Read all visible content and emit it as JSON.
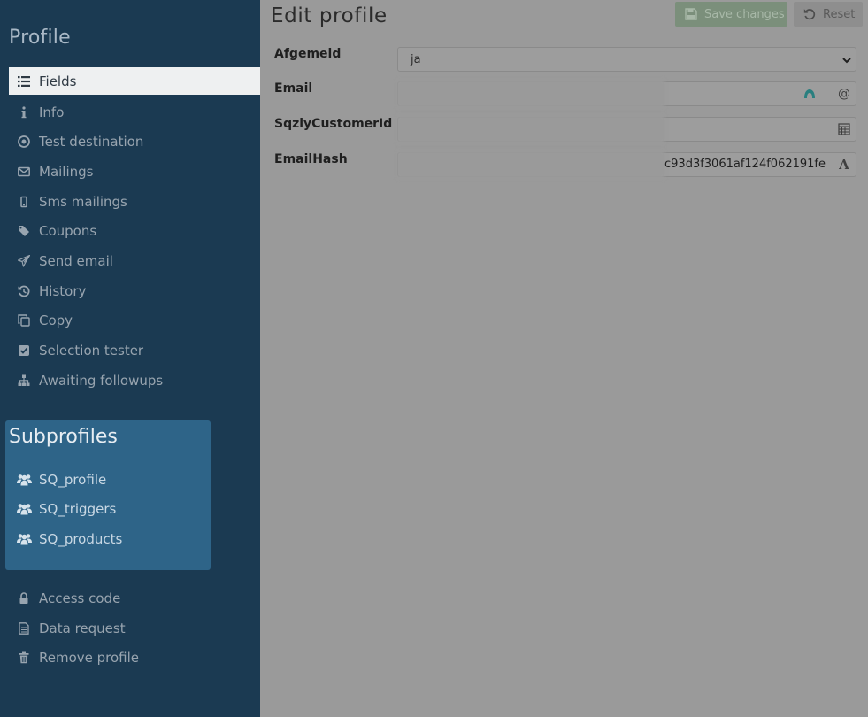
{
  "sidebar": {
    "title": "Profile",
    "items": [
      {
        "label": "Fields",
        "icon": "list-icon",
        "active": true
      },
      {
        "label": "Info",
        "icon": "info-icon"
      },
      {
        "label": "Test destination",
        "icon": "target-icon"
      },
      {
        "label": "Mailings",
        "icon": "envelope-icon"
      },
      {
        "label": "Sms mailings",
        "icon": "mobile-icon"
      },
      {
        "label": "Coupons",
        "icon": "tag-icon"
      },
      {
        "label": "Send email",
        "icon": "paper-plane-icon"
      },
      {
        "label": "History",
        "icon": "history-icon"
      },
      {
        "label": "Copy",
        "icon": "copy-icon"
      },
      {
        "label": "Selection tester",
        "icon": "check-square-icon"
      },
      {
        "label": "Awaiting followups",
        "icon": "sitemap-icon"
      }
    ],
    "subprofiles": {
      "title": "Subprofiles",
      "items": [
        {
          "label": "SQ_profile",
          "icon": "users-icon"
        },
        {
          "label": "SQ_triggers",
          "icon": "users-icon"
        },
        {
          "label": "SQ_products",
          "icon": "users-icon"
        }
      ]
    },
    "bottom_items": [
      {
        "label": "Access code",
        "icon": "lock-icon"
      },
      {
        "label": "Data request",
        "icon": "document-icon"
      },
      {
        "label": "Remove profile",
        "icon": "trash-icon"
      }
    ]
  },
  "main": {
    "title": "Edit profile",
    "toolbar": {
      "save_label": "Save changes",
      "reset_label": "Reset"
    },
    "fields": [
      {
        "label": "Afgemeld",
        "type": "select",
        "value": "ja"
      },
      {
        "label": "Email",
        "type": "email",
        "addon": "@"
      },
      {
        "label": "SqzlyCustomerId",
        "type": "number"
      },
      {
        "label": "EmailHash",
        "type": "text",
        "value_tail": "c93d3f3061af124f062191fe"
      }
    ]
  },
  "colors": {
    "sidebar_bg": "#1b3a52",
    "subprofiles_bg": "#2e6488",
    "active_item_bg": "#eef0f1",
    "overlay_bg": "#9a9a9a",
    "save_button_bg": "#7b8f7b"
  }
}
